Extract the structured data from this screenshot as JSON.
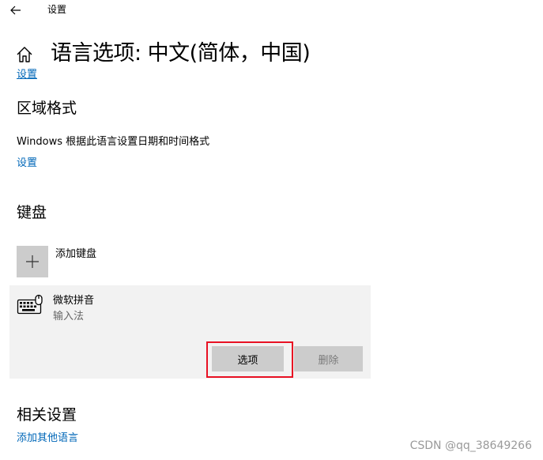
{
  "window": {
    "title": "设置",
    "back_icon": "arrow-left-icon"
  },
  "header": {
    "home_icon": "home-icon",
    "title": "语言选项: 中文(简体，中国)"
  },
  "clipped_link": "设置",
  "regional_format": {
    "heading": "区域格式",
    "description": "Windows 根据此语言设置日期和时间格式",
    "link": "设置"
  },
  "keyboards": {
    "heading": "键盘",
    "add_label": "添加键盘",
    "items": [
      {
        "name": "微软拼音",
        "subtitle": "输入法",
        "options_label": "选项",
        "remove_label": "删除"
      }
    ]
  },
  "related": {
    "heading": "相关设置",
    "link": "添加其他语言"
  },
  "watermark": "CSDN @qq_38649266",
  "colors": {
    "link": "#0067b8",
    "highlight": "#e81123",
    "panel": "#f2f2f2",
    "button": "#cccccc"
  }
}
